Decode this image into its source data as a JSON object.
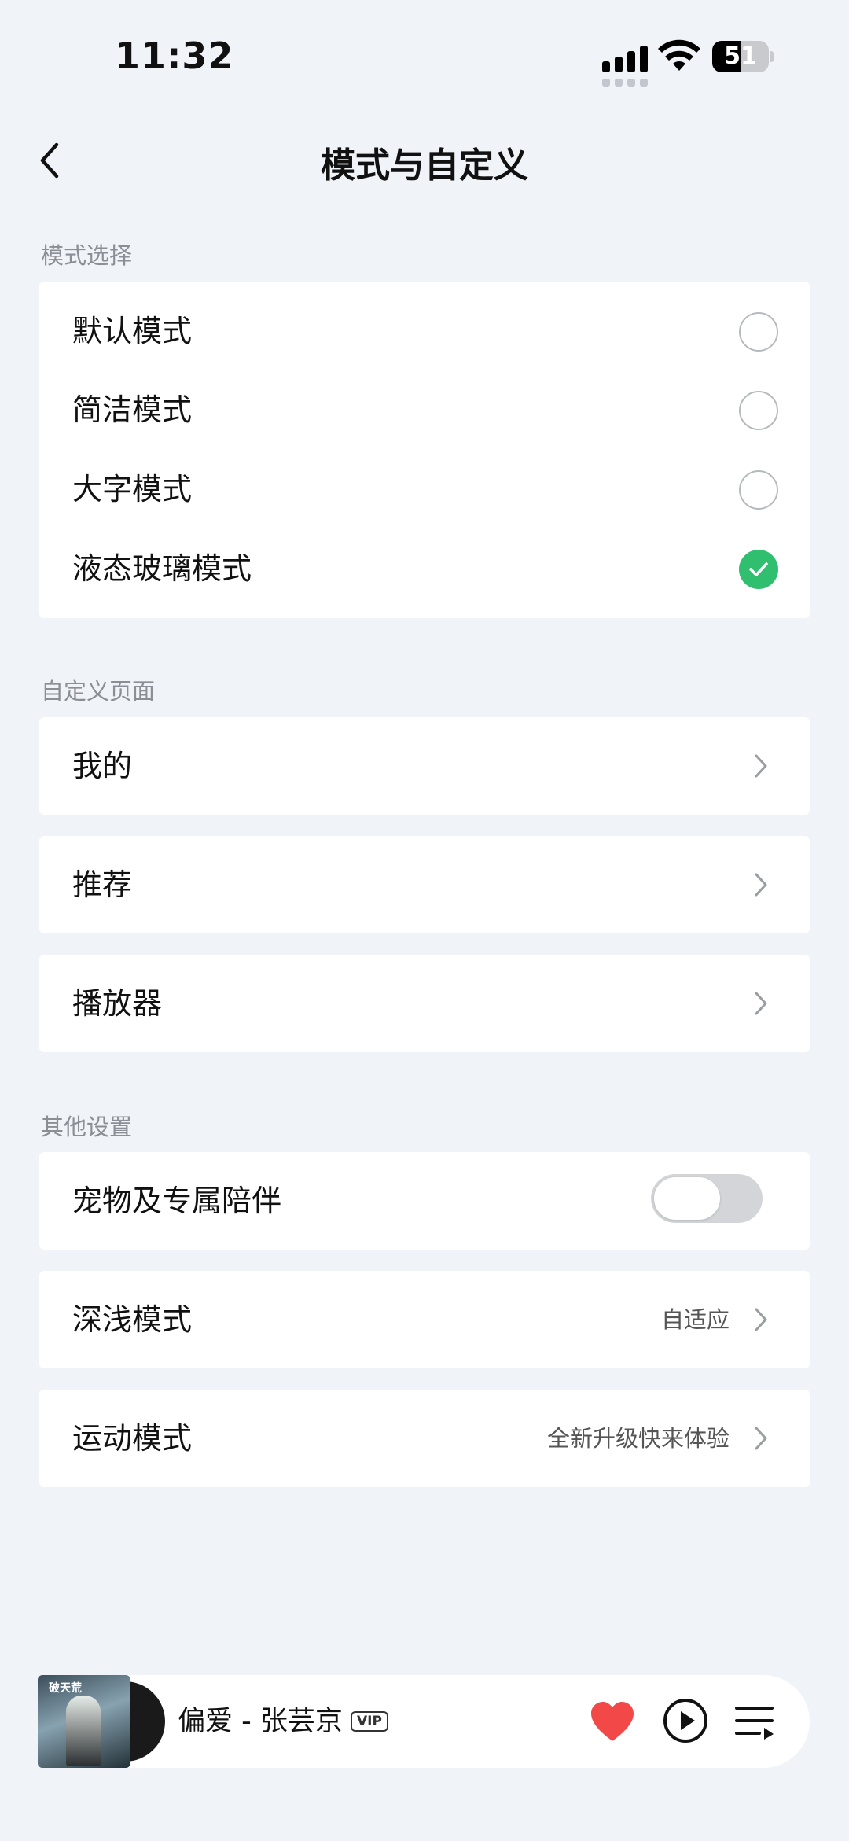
{
  "status_bar": {
    "time": "11:32",
    "battery": "51",
    "battery_level": 0.51
  },
  "nav": {
    "title": "模式与自定义"
  },
  "mode_section": {
    "label": "模式选择",
    "options": [
      {
        "label": "默认模式",
        "selected": false
      },
      {
        "label": "简洁模式",
        "selected": false
      },
      {
        "label": "大字模式",
        "selected": false
      },
      {
        "label": "液态玻璃模式",
        "selected": true
      }
    ]
  },
  "custom_section": {
    "label": "自定义页面",
    "items": [
      {
        "label": "我的"
      },
      {
        "label": "推荐"
      },
      {
        "label": "播放器"
      }
    ]
  },
  "other_section": {
    "label": "其他设置",
    "pet": {
      "label": "宠物及专属陪伴",
      "enabled": false
    },
    "dark_mode": {
      "label": "深浅模式",
      "value": "自适应"
    },
    "sport_mode": {
      "label": "运动模式",
      "value": "全新升级快来体验"
    }
  },
  "player": {
    "track": "偏爱 - 张芸京",
    "badge": "VIP",
    "cover_text": "破天荒",
    "liked": true
  },
  "colors": {
    "accent": "#2fbf6e",
    "heart": "#f24848",
    "background": "#f0f3f8"
  },
  "icons": [
    "back-arrow-icon",
    "chevron-right-icon",
    "check-icon",
    "heart-icon",
    "play-icon",
    "playlist-icon",
    "wifi-icon",
    "signal-icon",
    "battery-icon"
  ]
}
